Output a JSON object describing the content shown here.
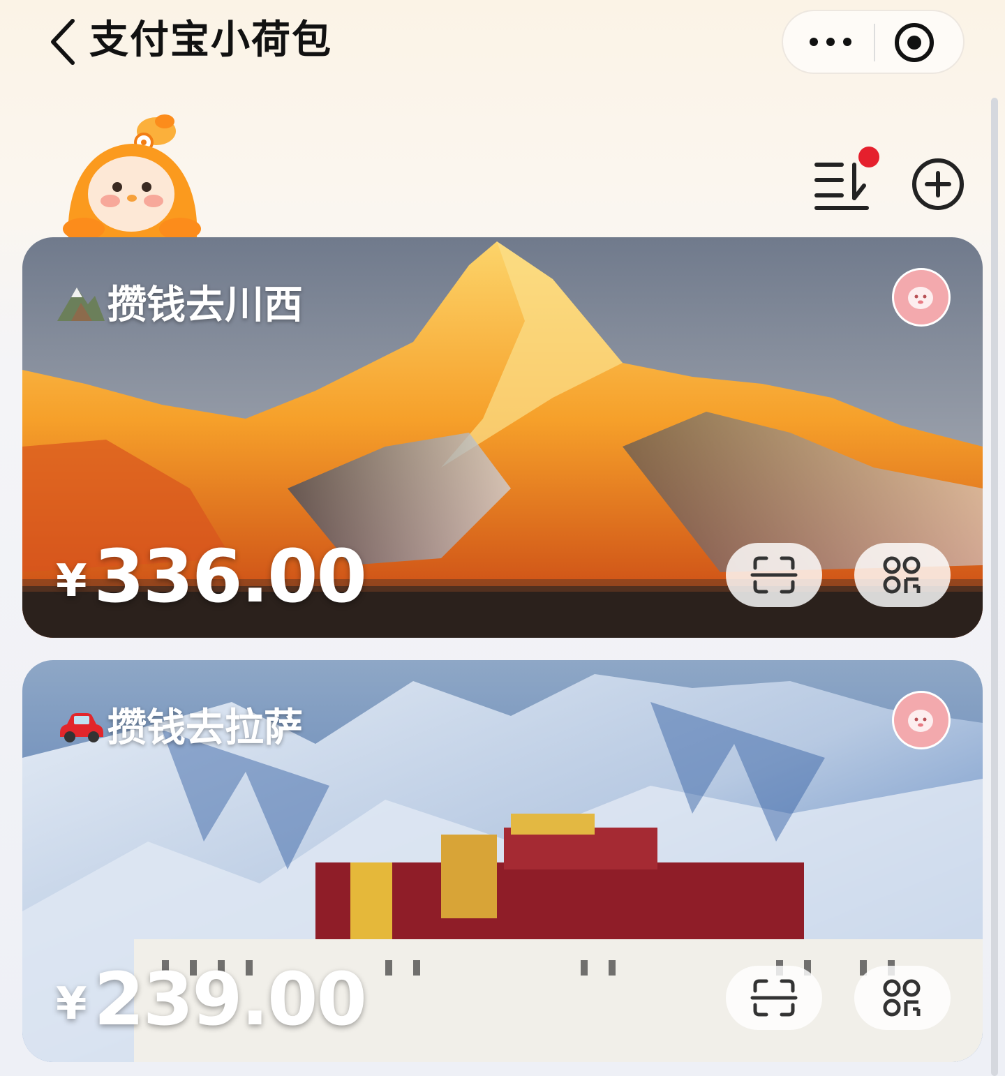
{
  "header": {
    "title": "支付宝小荷包"
  },
  "icons": {
    "back": "chevron-left-icon",
    "more": "more-dots-icon",
    "close": "target-close-icon",
    "sort": "sort-list-icon",
    "add": "plus-circle-icon",
    "mascot": "mascot-character",
    "scan": "scan-icon",
    "code": "payment-code-icon"
  },
  "badges": {
    "sort_notification": "red-dot"
  },
  "cards": [
    {
      "emoji": "mountain-emoji",
      "name": "攒钱去川西",
      "currency": "¥",
      "amount": "336.00"
    },
    {
      "emoji": "red-car-emoji",
      "name": "攒钱去拉萨",
      "currency": "¥",
      "amount": "239.00"
    }
  ],
  "colors": {
    "avatar_bg": "#f3a9ad",
    "badge_red": "#e5202d",
    "mascot_orange": "#fb9a1e"
  }
}
